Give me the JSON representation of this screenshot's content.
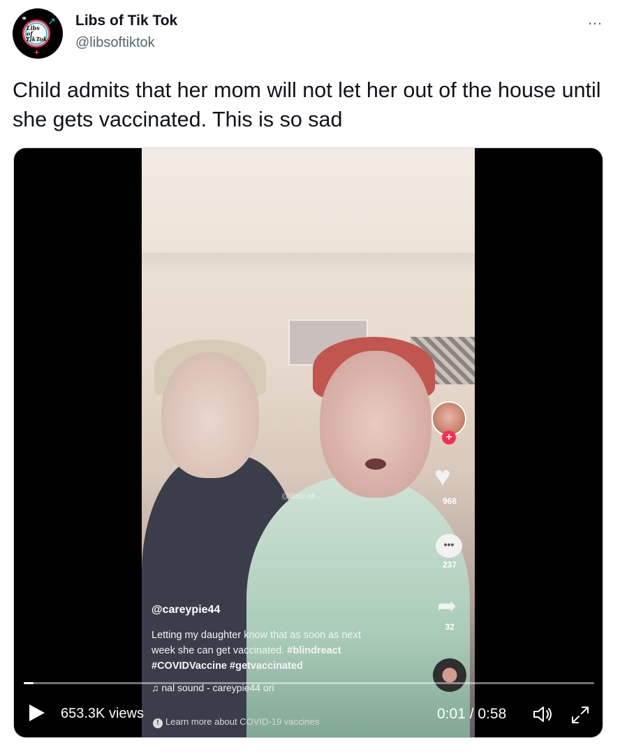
{
  "tweet": {
    "author": {
      "name": "Libs of Tik Tok",
      "handle": "@libsoftiktok",
      "avatar_text_line1": "Libs of",
      "avatar_text_line2": "TikTok"
    },
    "more_label": "…",
    "text": "Child admits that her mom will not let her out of the house until she gets vaccinated. This is so sad"
  },
  "video": {
    "tiktok": {
      "username": "@careypie44",
      "caption_line1": "Letting my daughter know that as soon as next",
      "caption_line2_text": "week she can get vaccinated. ",
      "caption_line2_tag": "#blindreact",
      "caption_line3": "#COVIDVaccine #getvaccinated",
      "sound_icon": "♫",
      "sound_text": "nal sound - careypie44    ori",
      "covid_info_icon": "!",
      "covid_notice": "Learn more about COVID-19 vaccines",
      "watermark": "@libso    ok",
      "likes": "968",
      "comments": "237",
      "shares": "32",
      "follow_icon": "+"
    },
    "player": {
      "views": "653.3K views",
      "time": "0:01 / 0:58",
      "progress_fraction": 0.017
    }
  },
  "icons": {
    "play": "play-icon",
    "volume": "volume-icon",
    "expand": "expand-icon",
    "more": "more-icon"
  },
  "colors": {
    "text": "#0f1419",
    "secondary": "#536471",
    "tiktok_red": "#fe2c55"
  }
}
